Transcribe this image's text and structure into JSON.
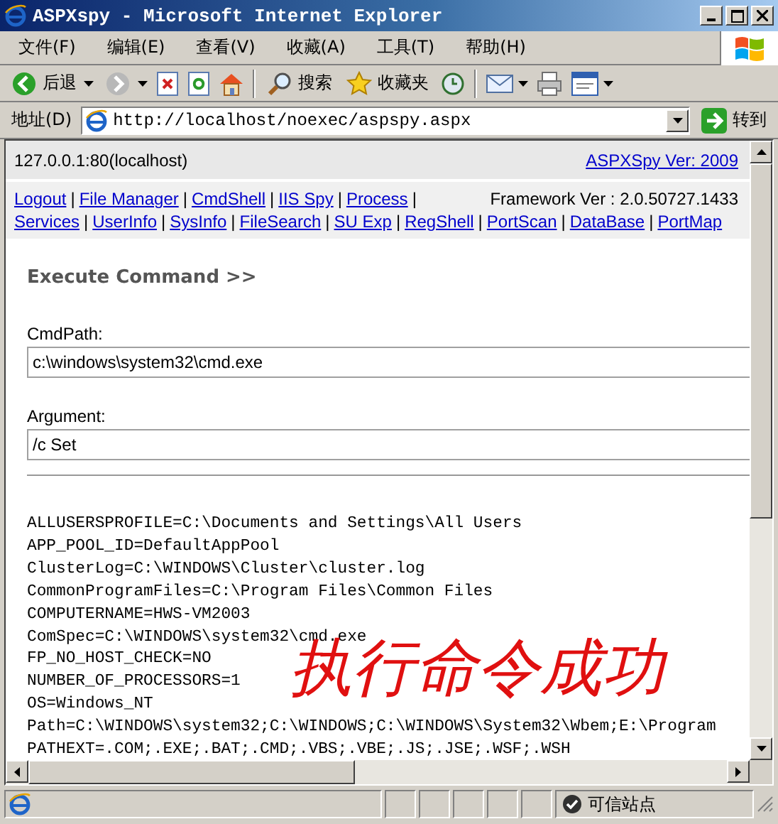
{
  "window": {
    "title": "ASPXspy - Microsoft Internet Explorer"
  },
  "menu": [
    {
      "label": "文件(F)"
    },
    {
      "label": "编辑(E)"
    },
    {
      "label": "查看(V)"
    },
    {
      "label": "收藏(A)"
    },
    {
      "label": "工具(T)"
    },
    {
      "label": "帮助(H)"
    }
  ],
  "toolbar": {
    "back_label": "后退",
    "search_label": "搜索",
    "favorites_label": "收藏夹"
  },
  "address": {
    "label": "地址(D)",
    "url": "http://localhost/noexec/aspspy.aspx",
    "go_label": "转到"
  },
  "page": {
    "host": "127.0.0.1:80(localhost)",
    "version_link": "ASPXSpy Ver: 2009",
    "framework": "Framework Ver : 2.0.50727.1433",
    "separator": "|",
    "nav_rows": [
      [
        "Logout",
        "File Manager",
        "CmdShell",
        "IIS Spy",
        "Process"
      ],
      [
        "Services",
        "UserInfo",
        "SysInfo",
        "FileSearch",
        "SU Exp",
        "RegShell",
        "PortScan",
        "DataBase",
        "PortMap"
      ]
    ],
    "heading": "Execute Command >>",
    "fields": [
      {
        "label": "CmdPath:",
        "value": "c:\\windows\\system32\\cmd.exe"
      },
      {
        "label": "Argument:",
        "value": "/c Set"
      }
    ],
    "output": [
      "ALLUSERSPROFILE=C:\\Documents and Settings\\All Users",
      "APP_POOL_ID=DefaultAppPool",
      "ClusterLog=C:\\WINDOWS\\Cluster\\cluster.log",
      "CommonProgramFiles=C:\\Program Files\\Common Files",
      "COMPUTERNAME=HWS-VM2003",
      "ComSpec=C:\\WINDOWS\\system32\\cmd.exe",
      "FP_NO_HOST_CHECK=NO",
      "NUMBER_OF_PROCESSORS=1",
      "OS=Windows_NT",
      "Path=C:\\WINDOWS\\system32;C:\\WINDOWS;C:\\WINDOWS\\System32\\Wbem;E:\\Program",
      "PATHEXT=.COM;.EXE;.BAT;.CMD;.VBS;.VBE;.JS;.JSE;.WSF;.WSH"
    ],
    "annotation": "执行命令成功"
  },
  "status_bar": {
    "zone": "可信站点"
  }
}
